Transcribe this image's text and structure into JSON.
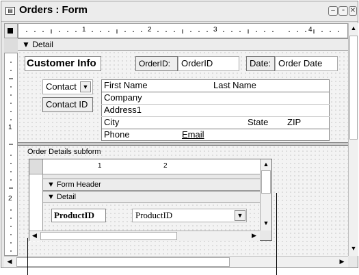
{
  "window": {
    "title": "Orders : Form"
  },
  "ruler": {
    "marks": [
      "1",
      "2",
      "3",
      "4"
    ]
  },
  "sections": {
    "detail": "Detail"
  },
  "form": {
    "customer_info": "Customer Info",
    "order_id_label": "OrderID:",
    "order_id_value": "OrderID",
    "date_label": "Date:",
    "date_value": "Order Date",
    "contact_combo": "Contact",
    "contact_id": "Contact ID",
    "first_name": "First Name",
    "last_name": "Last Name",
    "company": "Company",
    "address1": "Address1",
    "city": "City",
    "state": "State",
    "zip": "ZIP",
    "phone": "Phone",
    "email": "Email"
  },
  "subform": {
    "label": "Order Details subform",
    "ruler_marks": [
      "1",
      "2"
    ],
    "form_header": "Form Header",
    "detail": "Detail",
    "product_label": "ProductID",
    "product_value": "ProductID"
  },
  "icons": {
    "form": "form-icon",
    "minimize": "minimize-icon",
    "restore": "restore-icon",
    "close": "close-icon"
  }
}
